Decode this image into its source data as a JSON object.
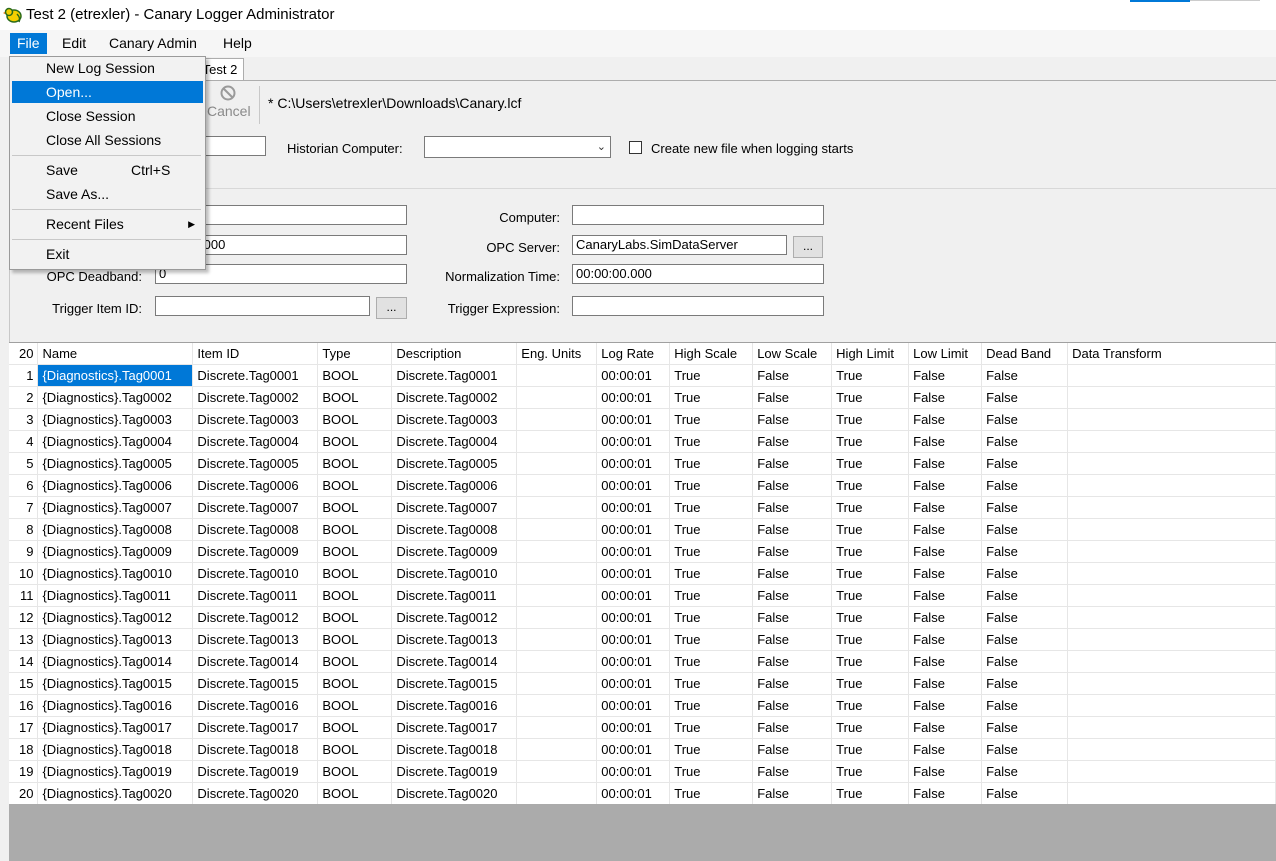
{
  "window": {
    "title": "Test 2 (etrexler) - Canary Logger Administrator"
  },
  "menubar": [
    "File",
    "Edit",
    "Canary Admin",
    "Help"
  ],
  "file_menu": {
    "items": [
      {
        "label": "New Log Session"
      },
      {
        "label": "Open..."
      },
      {
        "label": "Close Session"
      },
      {
        "label": "Close All Sessions"
      },
      {
        "label": "Save",
        "shortcut": "Ctrl+S"
      },
      {
        "label": "Save As..."
      },
      {
        "label": "Recent Files"
      },
      {
        "label": "Exit"
      }
    ]
  },
  "tabs": [
    "Test 2"
  ],
  "toolbar": {
    "cancel_label": "Cancel",
    "file_path": "* C:\\Users\\etrexler\\Downloads\\Canary.lcf"
  },
  "session": {
    "historian_label": "Historian Computer:",
    "historian_value": "",
    "create_file_label": "Create new file when logging starts",
    "create_file_checked": false
  },
  "settings": {
    "computer_label": "Computer:",
    "computer_value": "",
    "partial_value": ".000",
    "opc_server_label": "OPC Server:",
    "opc_server_value": "CanaryLabs.SimDataServer",
    "browse_label": "...",
    "opc_deadband_label": "OPC Deadband:",
    "opc_deadband_value": "0",
    "normalization_label": "Normalization Time:",
    "normalization_value": "00:00:00.000",
    "trigger_item_label": "Trigger Item ID:",
    "trigger_item_value": "",
    "trigger_browse_label": "...",
    "trigger_expr_label": "Trigger Expression:",
    "trigger_expr_value": ""
  },
  "grid": {
    "row_count_header": "20",
    "columns": [
      "Name",
      "Item ID",
      "Type",
      "Description",
      "Eng. Units",
      "Log Rate",
      "High Scale",
      "Low Scale",
      "High Limit",
      "Low Limit",
      "Dead Band",
      "Data Transform"
    ],
    "rows": [
      [
        "1",
        "{Diagnostics}.Tag0001",
        "Discrete.Tag0001",
        "BOOL",
        "Discrete.Tag0001",
        "",
        "00:00:01",
        "True",
        "False",
        "True",
        "False",
        "False",
        ""
      ],
      [
        "2",
        "{Diagnostics}.Tag0002",
        "Discrete.Tag0002",
        "BOOL",
        "Discrete.Tag0002",
        "",
        "00:00:01",
        "True",
        "False",
        "True",
        "False",
        "False",
        ""
      ],
      [
        "3",
        "{Diagnostics}.Tag0003",
        "Discrete.Tag0003",
        "BOOL",
        "Discrete.Tag0003",
        "",
        "00:00:01",
        "True",
        "False",
        "True",
        "False",
        "False",
        ""
      ],
      [
        "4",
        "{Diagnostics}.Tag0004",
        "Discrete.Tag0004",
        "BOOL",
        "Discrete.Tag0004",
        "",
        "00:00:01",
        "True",
        "False",
        "True",
        "False",
        "False",
        ""
      ],
      [
        "5",
        "{Diagnostics}.Tag0005",
        "Discrete.Tag0005",
        "BOOL",
        "Discrete.Tag0005",
        "",
        "00:00:01",
        "True",
        "False",
        "True",
        "False",
        "False",
        ""
      ],
      [
        "6",
        "{Diagnostics}.Tag0006",
        "Discrete.Tag0006",
        "BOOL",
        "Discrete.Tag0006",
        "",
        "00:00:01",
        "True",
        "False",
        "True",
        "False",
        "False",
        ""
      ],
      [
        "7",
        "{Diagnostics}.Tag0007",
        "Discrete.Tag0007",
        "BOOL",
        "Discrete.Tag0007",
        "",
        "00:00:01",
        "True",
        "False",
        "True",
        "False",
        "False",
        ""
      ],
      [
        "8",
        "{Diagnostics}.Tag0008",
        "Discrete.Tag0008",
        "BOOL",
        "Discrete.Tag0008",
        "",
        "00:00:01",
        "True",
        "False",
        "True",
        "False",
        "False",
        ""
      ],
      [
        "9",
        "{Diagnostics}.Tag0009",
        "Discrete.Tag0009",
        "BOOL",
        "Discrete.Tag0009",
        "",
        "00:00:01",
        "True",
        "False",
        "True",
        "False",
        "False",
        ""
      ],
      [
        "10",
        "{Diagnostics}.Tag0010",
        "Discrete.Tag0010",
        "BOOL",
        "Discrete.Tag0010",
        "",
        "00:00:01",
        "True",
        "False",
        "True",
        "False",
        "False",
        ""
      ],
      [
        "11",
        "{Diagnostics}.Tag0011",
        "Discrete.Tag0011",
        "BOOL",
        "Discrete.Tag0011",
        "",
        "00:00:01",
        "True",
        "False",
        "True",
        "False",
        "False",
        ""
      ],
      [
        "12",
        "{Diagnostics}.Tag0012",
        "Discrete.Tag0012",
        "BOOL",
        "Discrete.Tag0012",
        "",
        "00:00:01",
        "True",
        "False",
        "True",
        "False",
        "False",
        ""
      ],
      [
        "13",
        "{Diagnostics}.Tag0013",
        "Discrete.Tag0013",
        "BOOL",
        "Discrete.Tag0013",
        "",
        "00:00:01",
        "True",
        "False",
        "True",
        "False",
        "False",
        ""
      ],
      [
        "14",
        "{Diagnostics}.Tag0014",
        "Discrete.Tag0014",
        "BOOL",
        "Discrete.Tag0014",
        "",
        "00:00:01",
        "True",
        "False",
        "True",
        "False",
        "False",
        ""
      ],
      [
        "15",
        "{Diagnostics}.Tag0015",
        "Discrete.Tag0015",
        "BOOL",
        "Discrete.Tag0015",
        "",
        "00:00:01",
        "True",
        "False",
        "True",
        "False",
        "False",
        ""
      ],
      [
        "16",
        "{Diagnostics}.Tag0016",
        "Discrete.Tag0016",
        "BOOL",
        "Discrete.Tag0016",
        "",
        "00:00:01",
        "True",
        "False",
        "True",
        "False",
        "False",
        ""
      ],
      [
        "17",
        "{Diagnostics}.Tag0017",
        "Discrete.Tag0017",
        "BOOL",
        "Discrete.Tag0017",
        "",
        "00:00:01",
        "True",
        "False",
        "True",
        "False",
        "False",
        ""
      ],
      [
        "18",
        "{Diagnostics}.Tag0018",
        "Discrete.Tag0018",
        "BOOL",
        "Discrete.Tag0018",
        "",
        "00:00:01",
        "True",
        "False",
        "True",
        "False",
        "False",
        ""
      ],
      [
        "19",
        "{Diagnostics}.Tag0019",
        "Discrete.Tag0019",
        "BOOL",
        "Discrete.Tag0019",
        "",
        "00:00:01",
        "True",
        "False",
        "True",
        "False",
        "False",
        ""
      ],
      [
        "20",
        "{Diagnostics}.Tag0020",
        "Discrete.Tag0020",
        "BOOL",
        "Discrete.Tag0020",
        "",
        "00:00:01",
        "True",
        "False",
        "True",
        "False",
        "False",
        ""
      ]
    ]
  },
  "colors": {
    "accent": "#0078d7",
    "grid_empty": "#ababab"
  }
}
